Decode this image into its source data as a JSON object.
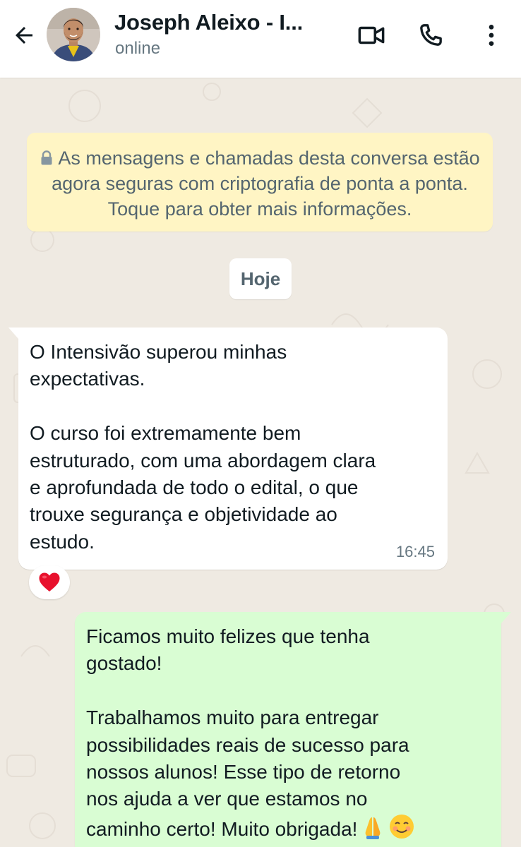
{
  "header": {
    "contact_name": "Joseph Aleixo - I...",
    "status": "online",
    "icons": {
      "back": "arrow-left-icon",
      "video": "video-camera-icon",
      "call": "phone-icon",
      "menu": "more-vertical-icon"
    }
  },
  "chat": {
    "encryption_notice": "As mensagens e chamadas desta conversa estão agora seguras com criptografia de ponta a ponta. Toque para obter mais informações.",
    "date_divider": "Hoje",
    "messages": [
      {
        "direction": "incoming",
        "text": "O Intensivão superou minhas\nexpectativas.\n\nO curso foi extremamente bem\nestruturado, com uma abordagem clara\ne aprofundada de todo o edital, o que\ntrouxe segurança e objetividade ao\nestudo.",
        "time": "16:45",
        "reaction": "red-heart"
      },
      {
        "direction": "outgoing",
        "text": "Ficamos muito felizes que tenha\ngostado!\n\nTrabalhamos muito para entregar\npossibilidades reais de sucesso para\nnossos alunos! Esse tipo de retorno\nnos ajuda a ver que estamos no\ncaminho certo! Muito obrigada!",
        "emojis": [
          "folded-hands",
          "smiling-face"
        ]
      }
    ]
  },
  "colors": {
    "header_bg": "#ffffff",
    "chat_bg": "#efeae2",
    "notice_bg": "#fff5c4",
    "incoming_bubble": "#ffffff",
    "outgoing_bubble": "#d9fdd3",
    "primary_text": "#111b21",
    "secondary_text": "#667781"
  }
}
